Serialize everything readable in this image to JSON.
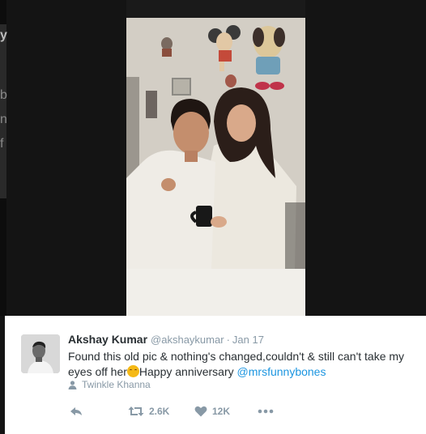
{
  "tweet": {
    "author_name": "Akshay Kumar",
    "handle": "@akshaykumar",
    "separator": "·",
    "date": "Jan 17",
    "text_part1": "Found this old pic & nothing's changed,couldn't & still can't take my eyes off her",
    "text_part2": "Happy anniversary ",
    "mention": "@mrsfunnybones",
    "tagged_user": "Twinkle Khanna",
    "retweet_count": "2.6K",
    "like_count": "12K"
  },
  "backdrop": {
    "partial_glyphs": [
      "y",
      "b",
      "n",
      "f"
    ]
  },
  "icons": {
    "reply": "reply-icon",
    "retweet": "retweet-icon",
    "like": "heart-icon",
    "more": "more-dots-icon",
    "tagged": "person-icon",
    "emoji": "smiling-face-emoji"
  },
  "colors": {
    "link": "#1b95e0",
    "secondary_text": "#8899a6",
    "primary_text": "#292f33",
    "backdrop": "#141414"
  }
}
